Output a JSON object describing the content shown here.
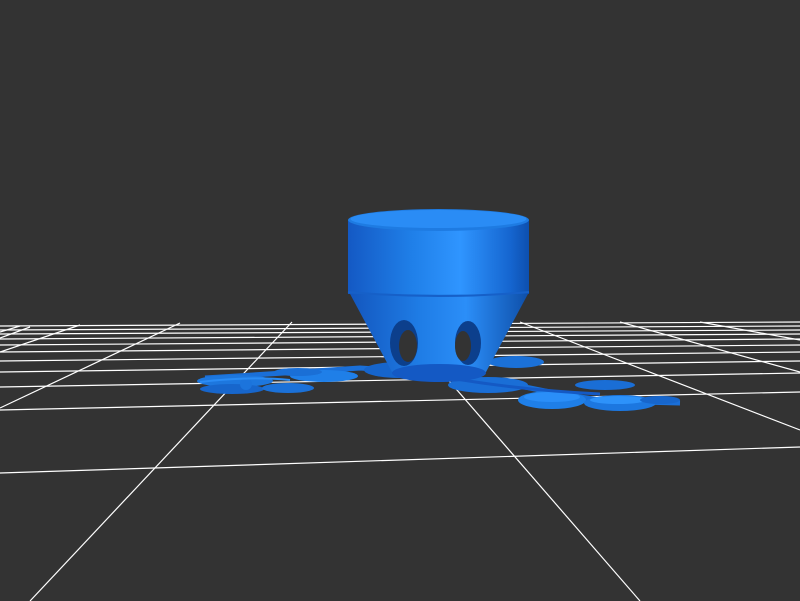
{
  "scene": {
    "background_color": "#333333",
    "grid_color": "#ffffff",
    "model_color": "#1f7fe8",
    "model_highlight_color": "#2f95ff",
    "model_shadow_color": "#0b4fae"
  }
}
